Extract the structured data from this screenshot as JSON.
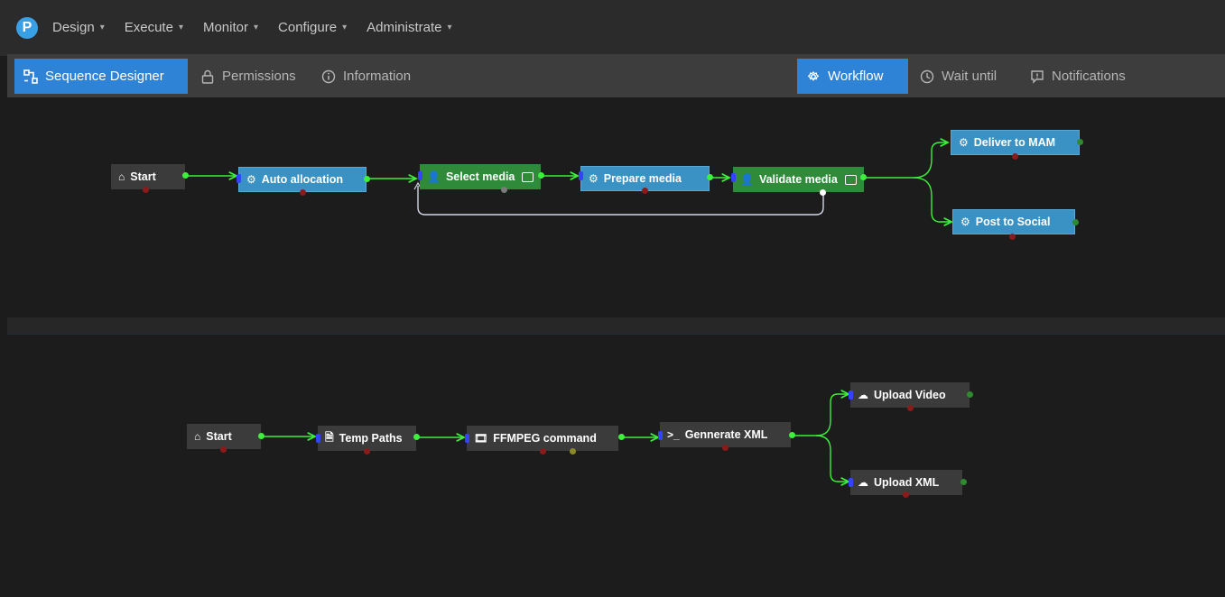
{
  "app": {
    "logo_letter": "P"
  },
  "menu": [
    {
      "label": "Design",
      "caret": "▾"
    },
    {
      "label": "Execute",
      "caret": "▾"
    },
    {
      "label": "Monitor",
      "caret": "▾"
    },
    {
      "label": "Configure",
      "caret": "▾"
    },
    {
      "label": "Administrate",
      "caret": "▾"
    }
  ],
  "toolbar": {
    "left": [
      {
        "label": "Sequence Designer",
        "icon": "sequence-icon",
        "active": true
      },
      {
        "label": "Permissions",
        "icon": "lock-icon",
        "active": false
      },
      {
        "label": "Information",
        "icon": "info-icon",
        "active": false
      }
    ],
    "right": [
      {
        "label": "Workflow",
        "icon": "gear-icon",
        "active": true
      },
      {
        "label": "Wait until",
        "icon": "clock-icon",
        "active": false
      },
      {
        "label": "Notifications",
        "icon": "comment-icon",
        "active": false
      }
    ]
  },
  "flow1": {
    "start": "Start",
    "auto_allocation": "Auto allocation",
    "select_media": "Select media",
    "prepare_media": "Prepare media",
    "validate_media": "Validate media",
    "deliver_to_mam": "Deliver to MAM",
    "post_to_social": "Post to Social"
  },
  "flow2": {
    "start": "Start",
    "temp_paths": "Temp Paths",
    "ffmpeg_command": "FFMPEG command",
    "generate_xml": "Gennerate XML",
    "upload_video": "Upload Video",
    "upload_xml": "Upload XML"
  },
  "icons": {
    "home": "⌂",
    "user": "👤",
    "gear": "⚙",
    "cloud": "☁",
    "film": "🎞",
    "terminal": ">_",
    "file": "🗎"
  },
  "colors": {
    "accent": "#2f83d6",
    "node_blue": "#3a91c3",
    "node_green": "#2f8a3a",
    "node_gray": "#3b3b3b",
    "wire": "#3cf03c"
  }
}
